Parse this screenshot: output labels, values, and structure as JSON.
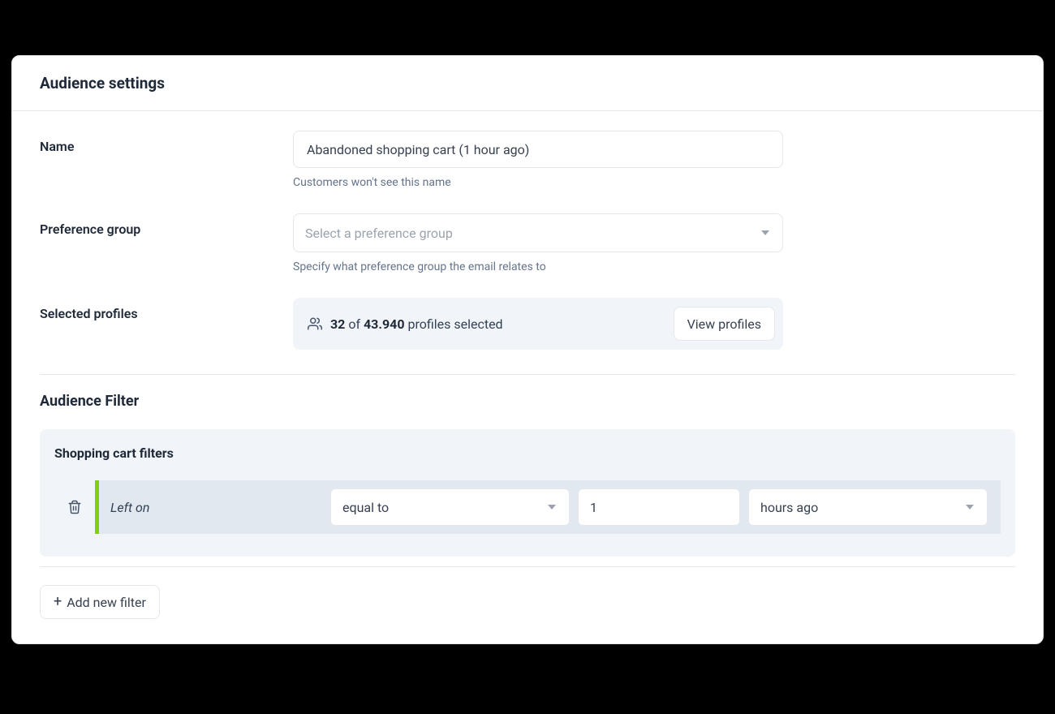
{
  "header": {
    "title": "Audience settings"
  },
  "name": {
    "label": "Name",
    "value": "Abandoned shopping cart (1 hour ago)",
    "helper": "Customers won't see this name"
  },
  "pref_group": {
    "label": "Preference group",
    "placeholder": "Select a preference group",
    "helper": "Specify what preference group the email relates to"
  },
  "profiles": {
    "label": "Selected profiles",
    "count": "32",
    "of_word": "of",
    "total": "43.940",
    "tail": "profiles selected",
    "view_btn": "View profiles"
  },
  "filter": {
    "section_title": "Audience Filter",
    "group_title": "Shopping cart filters",
    "rule": {
      "field_label": "Left on",
      "operator": "equal to",
      "value": "1",
      "unit": "hours ago"
    },
    "add_btn": "Add new filter"
  },
  "colors": {
    "accent_green": "#84cc16",
    "panel": "#f1f5f9",
    "text": "#1f2937"
  }
}
